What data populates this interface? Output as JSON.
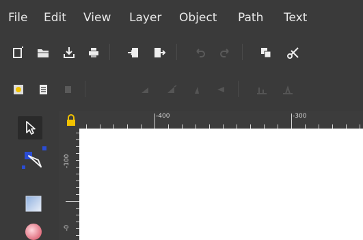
{
  "menubar": {
    "items": [
      {
        "label": "File"
      },
      {
        "label": "Edit"
      },
      {
        "label": "View"
      },
      {
        "label": "Layer"
      },
      {
        "label": "Object"
      },
      {
        "label": "Path"
      },
      {
        "label": "Text"
      }
    ]
  },
  "toolbar_commands": {
    "icons": [
      "new-document-icon",
      "open-folder-icon",
      "save-icon",
      "print-icon",
      "import-icon",
      "export-icon",
      "undo-icon",
      "redo-icon",
      "duplicate-icon",
      "cut-icon"
    ]
  },
  "toolbar_snap": {
    "icons": [
      "zoom-selection-icon",
      "zoom-drawing-icon",
      "zoom-page-icon",
      "align-left-icon",
      "align-center-icon",
      "align-right-icon",
      "align-top-icon",
      "align-middle-icon",
      "align-bottom-icon"
    ]
  },
  "tools": {
    "icons": [
      "selector-arrow-icon",
      "node-editor-icon",
      "rectangle-tool-icon",
      "circle-tool-icon"
    ],
    "active": "selector-arrow-icon"
  },
  "ruler": {
    "lock_icon": "lock-icon",
    "horizontal_labels": [
      "-400",
      "-300"
    ],
    "vertical_labels": [
      "-100",
      "-0"
    ]
  },
  "colors": {
    "ui_background": "#3a3a3a",
    "canvas": "#ffffff",
    "selection_blue": "#2b4dd4",
    "lock_yellow": "#f2c200"
  }
}
